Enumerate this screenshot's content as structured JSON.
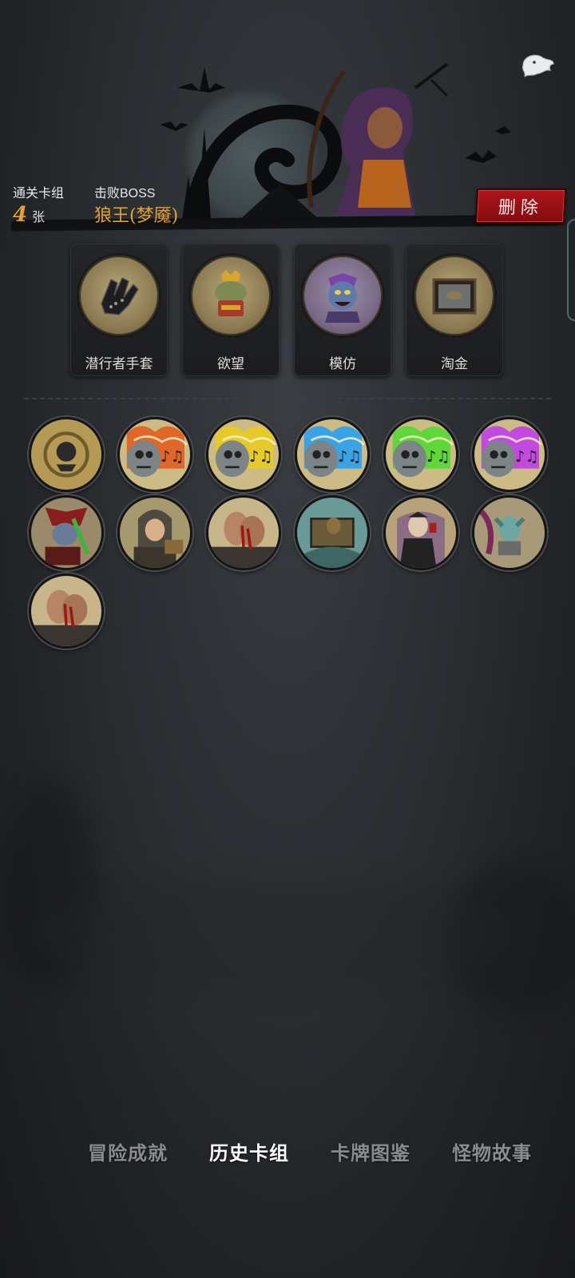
{
  "summary": {
    "deck_label": "通关卡组",
    "deck_count": "4",
    "deck_unit": "张",
    "boss_label": "击败BOSS",
    "boss_name": "狼王(梦魇)"
  },
  "delete_button": "删除",
  "relics": [
    {
      "label": "潜行者手套",
      "icon": "gloves-icon"
    },
    {
      "label": "欲望",
      "icon": "frog-king-icon"
    },
    {
      "label": "模仿",
      "icon": "goblin-icon"
    },
    {
      "label": "淘金",
      "icon": "gold-pan-icon"
    }
  ],
  "cards": [
    {
      "icon": "skull-coin-card",
      "color": "#b59a55"
    },
    {
      "icon": "music-skull-red-card",
      "color": "#e0662a"
    },
    {
      "icon": "music-skull-yellow-card",
      "color": "#e6c92a"
    },
    {
      "icon": "music-skull-blue-card",
      "color": "#3aa3e6"
    },
    {
      "icon": "music-skull-green-card",
      "color": "#5fd63a"
    },
    {
      "icon": "music-skull-purple-card",
      "color": "#c24ae0"
    },
    {
      "icon": "demon-guitar-card",
      "color": "#8e2a2a"
    },
    {
      "icon": "hooded-thief-card",
      "color": "#6c6a52"
    },
    {
      "icon": "bloody-hands-card",
      "color": "#9a7a55"
    },
    {
      "icon": "scarecrow-crate-card",
      "color": "#4f8080"
    },
    {
      "icon": "vampire-card",
      "color": "#8a6a5a"
    },
    {
      "icon": "gargoyle-card",
      "color": "#5e8a86"
    },
    {
      "icon": "bloody-hands-card",
      "color": "#9a7a55"
    }
  ],
  "tabs": [
    {
      "label": "冒险成就",
      "active": false
    },
    {
      "label": "历史卡组",
      "active": true
    },
    {
      "label": "卡牌图鉴",
      "active": false
    },
    {
      "label": "怪物故事",
      "active": false
    }
  ]
}
